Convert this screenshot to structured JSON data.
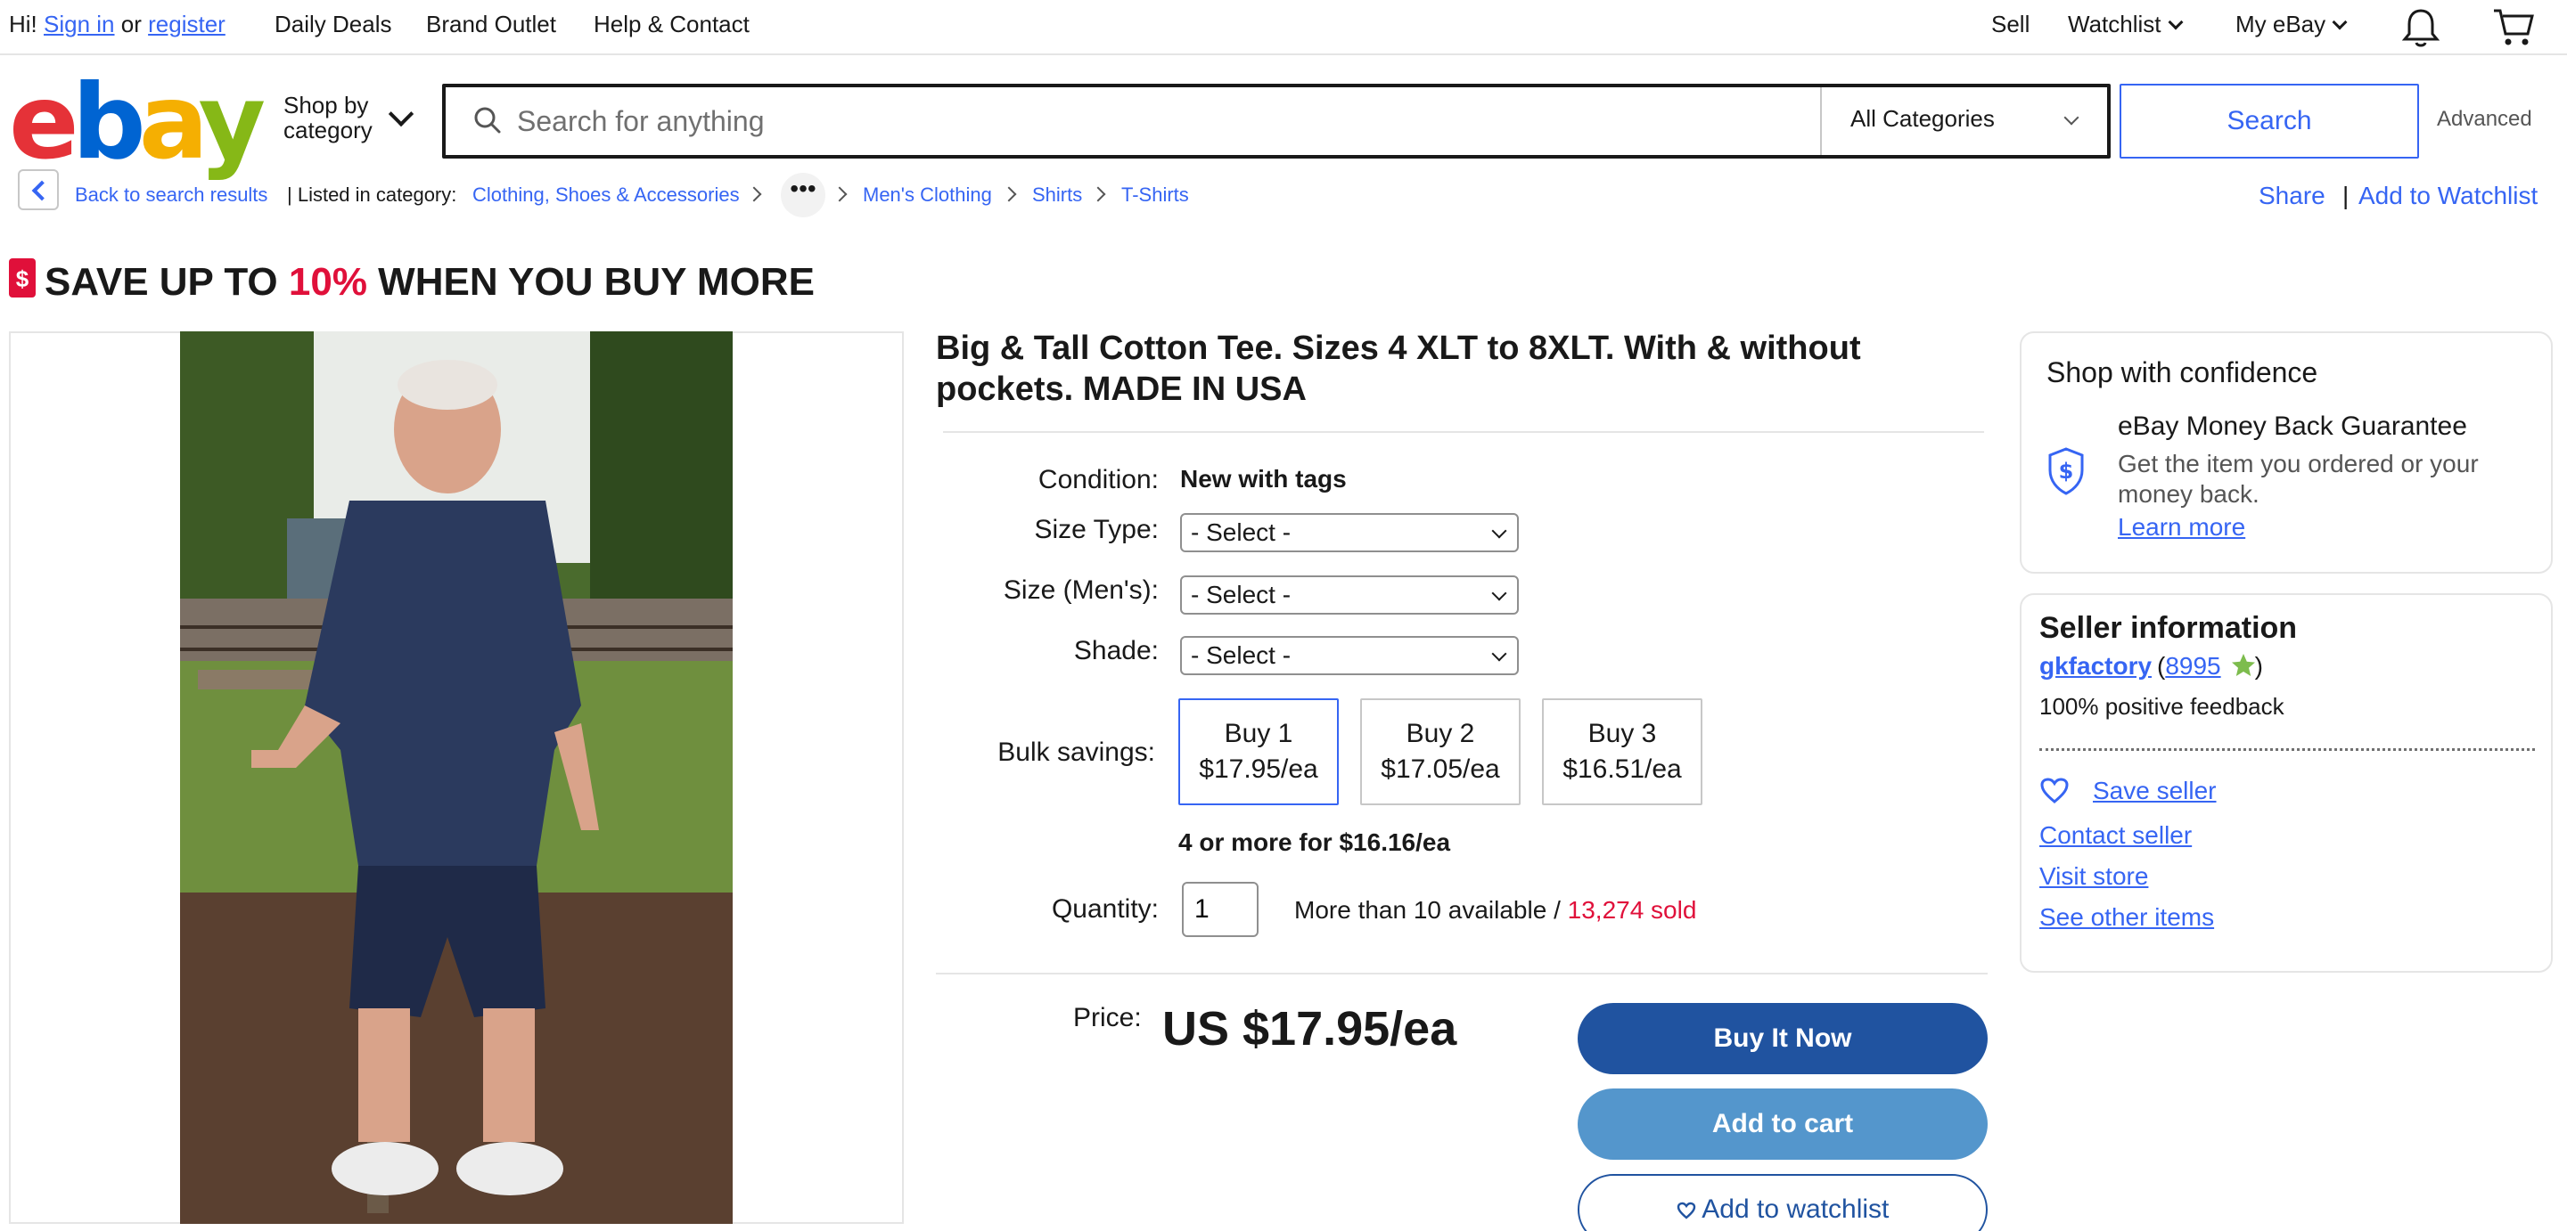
{
  "topbar": {
    "greeting": "Hi!",
    "sign_in": "Sign in",
    "or": "or",
    "register": "register",
    "daily_deals": "Daily Deals",
    "brand_outlet": "Brand Outlet",
    "help_contact": "Help & Contact",
    "sell": "Sell",
    "watchlist": "Watchlist",
    "my_ebay": "My eBay",
    "icons": [
      "bell-icon",
      "cart-icon"
    ]
  },
  "header": {
    "logo_letters": [
      "e",
      "b",
      "a",
      "y"
    ],
    "shop_by_1": "Shop by",
    "shop_by_2": "category",
    "search_placeholder": "Search for anything",
    "category_selected": "All Categories",
    "search_button": "Search",
    "advanced": "Advanced"
  },
  "breadcrumb": {
    "back": "Back to search results",
    "listed_in": "| Listed in category:",
    "items": [
      "Clothing, Shoes & Accessories",
      "Men's Clothing",
      "Shirts",
      "T-Shirts"
    ],
    "more": "•••",
    "share": "Share",
    "separator": "|",
    "add_to_watchlist": "Add to Watchlist"
  },
  "promo": {
    "prefix": "SAVE UP TO ",
    "highlight": "10%",
    "suffix": " WHEN YOU BUY MORE",
    "accent_color": "#e0103a"
  },
  "item": {
    "title": "Big & Tall Cotton Tee. Sizes 4 XLT to 8XLT. With & without pockets. MADE IN USA",
    "condition_label": "Condition:",
    "condition_value": "New with tags",
    "size_type_label": "Size Type:",
    "size_mens_label": "Size (Men's):",
    "shade_label": "Shade:",
    "select_placeholder": "- Select -",
    "bulk_label": "Bulk savings:",
    "bulk_options": [
      {
        "qty": "Buy 1",
        "price": "$17.95/ea"
      },
      {
        "qty": "Buy 2",
        "price": "$17.05/ea"
      },
      {
        "qty": "Buy 3",
        "price": "$16.51/ea"
      }
    ],
    "bulk_more": "4 or more for $16.16/ea",
    "quantity_label": "Quantity:",
    "quantity_value": "1",
    "availability": "More than 10 available / ",
    "sold": "13,274 sold",
    "price_label": "Price:",
    "price": "US $17.95/ea",
    "buy_now": "Buy It Now",
    "add_to_cart": "Add to cart",
    "add_to_watchlist": "Add to watchlist"
  },
  "confidence": {
    "title": "Shop with confidence",
    "mbg_title": "eBay Money Back Guarantee",
    "mbg_desc": "Get the item you ordered or your money back.",
    "learn_more": "Learn more"
  },
  "seller": {
    "title": "Seller information",
    "name": "gkfactory",
    "score_open": "(",
    "score": "8995",
    "score_close": ")",
    "positive": "100% positive feedback",
    "save_seller": "Save seller",
    "contact_seller": "Contact seller",
    "visit_store": "Visit store",
    "see_other": "See other items"
  },
  "colors": {
    "link": "#3665f3",
    "buy_now": "#2053a0",
    "add_to_cart": "#5496cc"
  }
}
